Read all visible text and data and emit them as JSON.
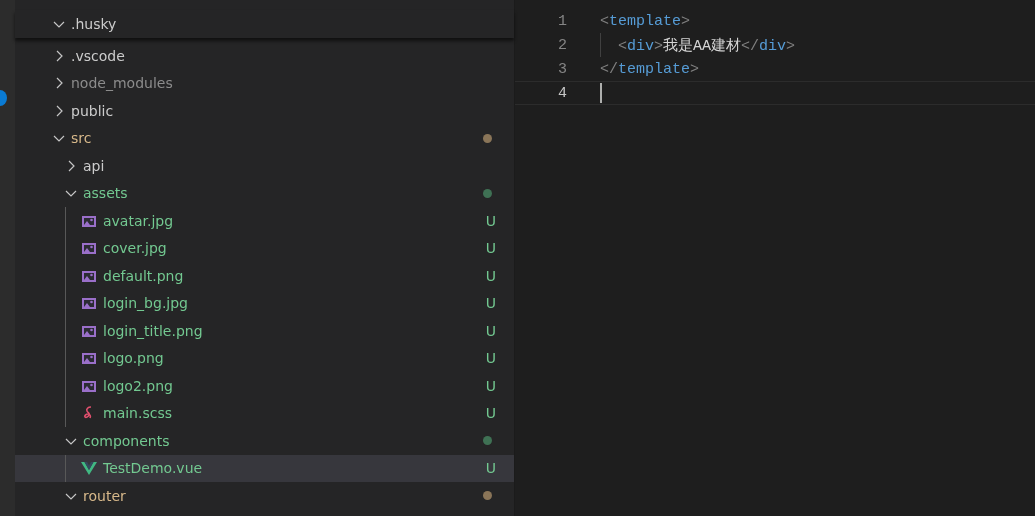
{
  "explorer": {
    "sticky_header": {
      "label": ".husky",
      "kind": "folder",
      "expanded": true,
      "ignored": false,
      "modified": false,
      "untracked": false
    },
    "tree": [
      {
        "label": ".vscode",
        "kind": "folder",
        "expanded": false,
        "ignored": false,
        "modified": false,
        "untracked": false
      },
      {
        "label": "node_modules",
        "kind": "folder",
        "expanded": false,
        "ignored": true,
        "modified": false,
        "untracked": false
      },
      {
        "label": "public",
        "kind": "folder",
        "expanded": false,
        "ignored": false,
        "modified": false,
        "untracked": false
      },
      {
        "label": "src",
        "kind": "folder",
        "expanded": true,
        "ignored": false,
        "modified": true,
        "untracked": false,
        "color": "#8a7558",
        "children": [
          {
            "label": "api",
            "kind": "folder",
            "expanded": false,
            "ignored": false,
            "modified": false,
            "untracked": false
          },
          {
            "label": "assets",
            "kind": "folder",
            "expanded": true,
            "ignored": false,
            "modified": false,
            "untracked": true,
            "color": "#3f7154",
            "children": [
              {
                "label": "avatar.jpg",
                "kind": "image",
                "ignored": false,
                "modified": false,
                "untracked": true,
                "badge": "U",
                "selected": false
              },
              {
                "label": "cover.jpg",
                "kind": "image",
                "ignored": false,
                "modified": false,
                "untracked": true,
                "badge": "U",
                "selected": false
              },
              {
                "label": "default.png",
                "kind": "image",
                "ignored": false,
                "modified": false,
                "untracked": true,
                "badge": "U",
                "selected": false
              },
              {
                "label": "login_bg.jpg",
                "kind": "image",
                "ignored": false,
                "modified": false,
                "untracked": true,
                "badge": "U",
                "selected": false
              },
              {
                "label": "login_title.png",
                "kind": "image",
                "ignored": false,
                "modified": false,
                "untracked": true,
                "badge": "U",
                "selected": false
              },
              {
                "label": "logo.png",
                "kind": "image",
                "ignored": false,
                "modified": false,
                "untracked": true,
                "badge": "U",
                "selected": false
              },
              {
                "label": "logo2.png",
                "kind": "image",
                "ignored": false,
                "modified": false,
                "untracked": true,
                "badge": "U",
                "selected": false
              },
              {
                "label": "main.scss",
                "kind": "sass",
                "ignored": false,
                "modified": false,
                "untracked": true,
                "badge": "U",
                "selected": false
              }
            ]
          },
          {
            "label": "components",
            "kind": "folder",
            "expanded": true,
            "ignored": false,
            "modified": false,
            "untracked": true,
            "color": "#3f7154",
            "children": [
              {
                "label": "TestDemo.vue",
                "kind": "vue",
                "ignored": false,
                "modified": false,
                "untracked": true,
                "badge": "U",
                "selected": true
              }
            ]
          },
          {
            "label": "router",
            "kind": "folder",
            "expanded": true,
            "ignored": false,
            "modified": true,
            "untracked": false,
            "color": "#8a7558"
          }
        ]
      }
    ]
  },
  "editor": {
    "lines": [
      {
        "number": "1",
        "current": false,
        "indented": false,
        "tokens": [
          {
            "text": "<",
            "kind": "punct"
          },
          {
            "text": "template",
            "kind": "tag"
          },
          {
            "text": ">",
            "kind": "punct"
          }
        ]
      },
      {
        "number": "2",
        "current": false,
        "indented": true,
        "tokens": [
          {
            "text": "<",
            "kind": "punct"
          },
          {
            "text": "div",
            "kind": "tag"
          },
          {
            "text": ">",
            "kind": "punct"
          },
          {
            "text": "我是AA建材",
            "kind": "text"
          },
          {
            "text": "</",
            "kind": "punct"
          },
          {
            "text": "div",
            "kind": "tag"
          },
          {
            "text": ">",
            "kind": "punct"
          }
        ]
      },
      {
        "number": "3",
        "current": false,
        "indented": false,
        "tokens": [
          {
            "text": "</",
            "kind": "punct"
          },
          {
            "text": "template",
            "kind": "tag"
          },
          {
            "text": ">",
            "kind": "punct"
          }
        ]
      },
      {
        "number": "4",
        "current": true,
        "indented": false
      }
    ]
  }
}
